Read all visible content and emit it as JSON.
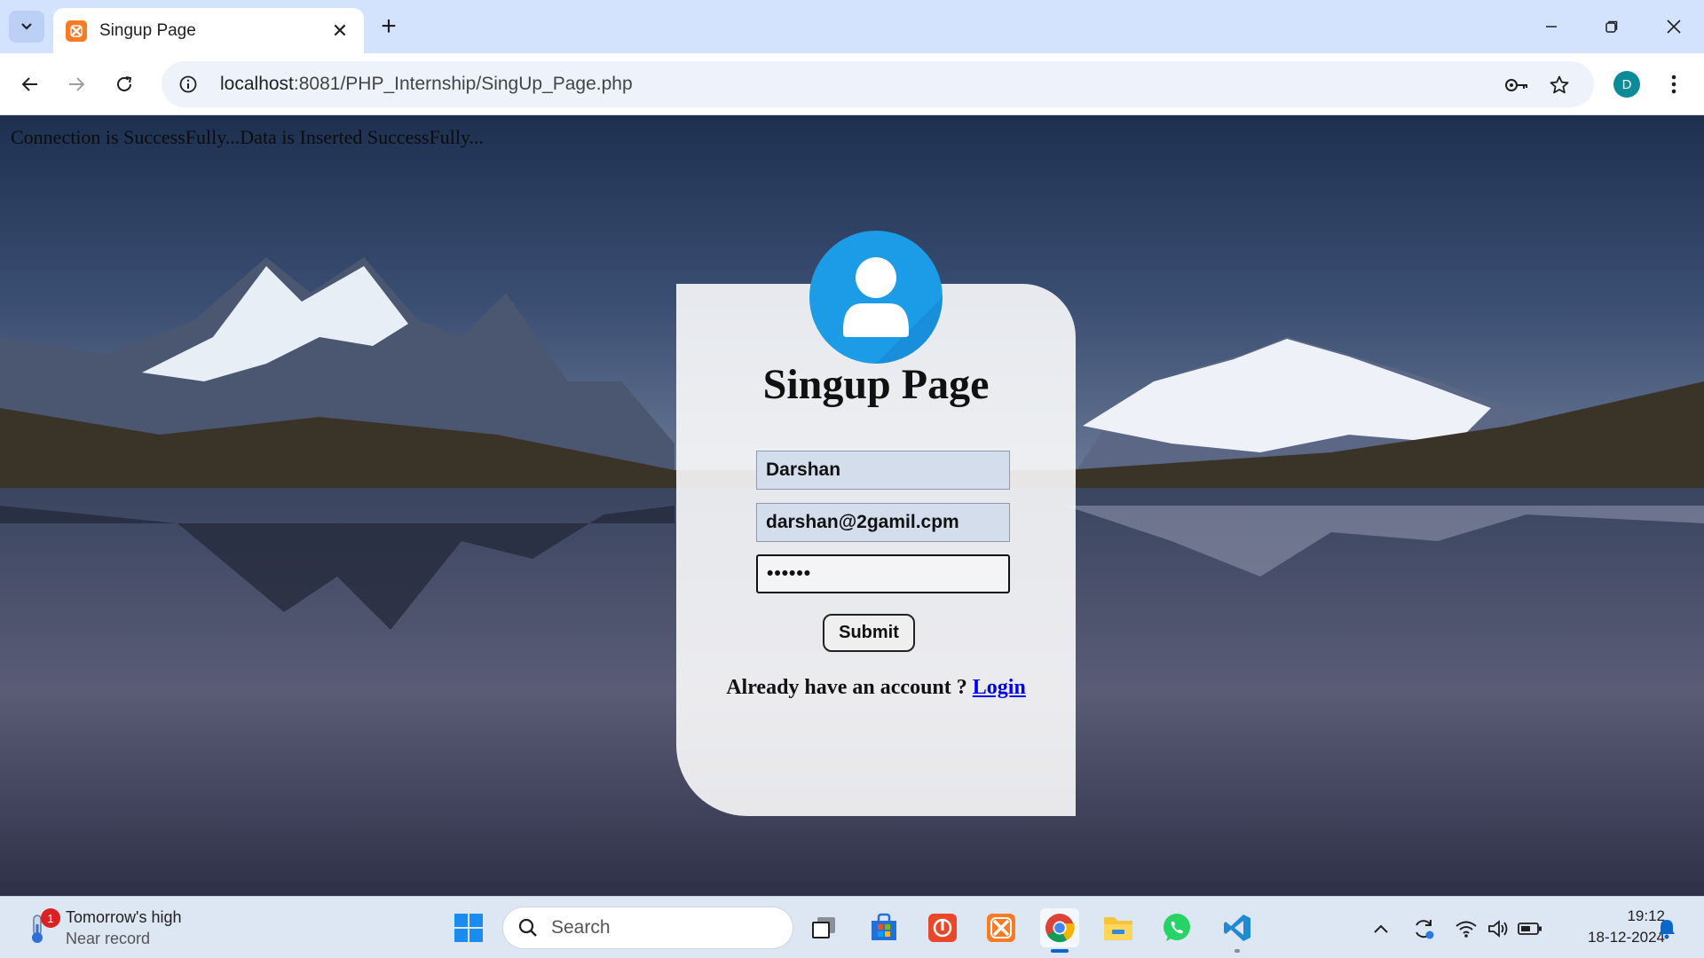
{
  "browser": {
    "tab": {
      "title": "Singup Page"
    },
    "address_bar": {
      "host": "localhost",
      "rest": ":8081/PHP_Internship/SingUp_Page.php"
    },
    "profile_initial": "D"
  },
  "page": {
    "status_message": "Connection is SuccessFully...Data is Inserted SuccessFully...",
    "title": "Singup Page",
    "form": {
      "name_value": "Darshan",
      "email_value": "darshan@2gamil.cpm",
      "password_value": "••••••",
      "submit_label": "Submit"
    },
    "login_prompt": "Already have an account ? ",
    "login_link": "Login"
  },
  "taskbar": {
    "weather": {
      "title": "Tomorrow's high",
      "subtitle": "Near record",
      "badge": "1"
    },
    "search_label": "Search",
    "clock": {
      "time": "19:12",
      "date": "18-12-2024"
    }
  },
  "colors": {
    "accent_blue": "#1c9be6",
    "link": "#0000ee",
    "tabstrip": "#d3e3fd"
  }
}
